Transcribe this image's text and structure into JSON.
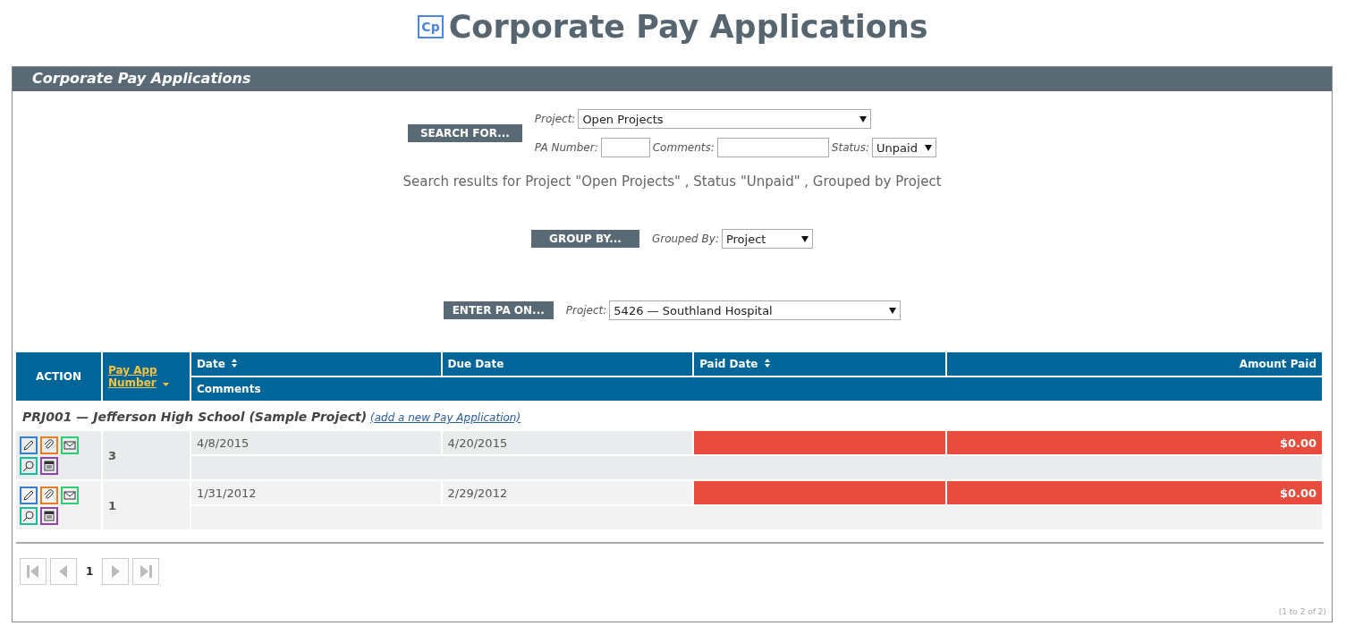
{
  "page_title": {
    "logo": "Cp",
    "text": "Corporate Pay Applications"
  },
  "panel": {
    "title": "Corporate Pay Applications"
  },
  "search": {
    "button": "SEARCH FOR...",
    "project_label": "Project:",
    "project_value": "Open Projects",
    "pa_label": "PA Number:",
    "comments_label": "Comments:",
    "status_label": "Status:",
    "status_value": "Unpaid",
    "summary": "Search results for Project \"Open Projects\" , Status \"Unpaid\" , Grouped by Project"
  },
  "group_by": {
    "button": "GROUP BY...",
    "label": "Grouped By:",
    "value": "Project"
  },
  "enter_pa": {
    "button": "ENTER PA ON...",
    "label": "Project:",
    "value": "5426 — Southland Hospital"
  },
  "table": {
    "columns": [
      {
        "label": "ACTION",
        "sortable": false,
        "sorted": false
      },
      {
        "label": "Pay App Number",
        "sortable": true,
        "sorted": true
      },
      {
        "label": "Date",
        "sortable": true,
        "sorted": false
      },
      {
        "label": "Due Date",
        "sortable": false,
        "sorted": false
      },
      {
        "label": "Paid Date",
        "sortable": true,
        "sorted": false
      },
      {
        "label": "Amount Paid",
        "sortable": false,
        "sorted": false
      }
    ],
    "sub_column": "Comments",
    "group": {
      "title": "PRJ001 — Jefferson High School (Sample Project)",
      "link": "(add a new Pay Application)"
    },
    "rows": [
      {
        "number": "3",
        "date": "4/8/2015",
        "due_date": "4/20/2015",
        "amount_paid": "$0.00",
        "overdue": true,
        "actions": [
          {
            "kind": "edit",
            "color": "#3a7dc9"
          },
          {
            "kind": "attach",
            "color": "#e67e22"
          },
          {
            "kind": "email",
            "color": "#2ecc71"
          },
          {
            "kind": "view",
            "color": "#1abc9c"
          },
          {
            "kind": "calendar",
            "color": "#8e44ad"
          }
        ]
      },
      {
        "number": "1",
        "date": "1/31/2012",
        "due_date": "2/29/2012",
        "amount_paid": "$0.00",
        "overdue": true,
        "actions": [
          {
            "kind": "edit",
            "color": "#3a7dc9"
          },
          {
            "kind": "attach",
            "color": "#e67e22"
          },
          {
            "kind": "email",
            "color": "#2ecc71"
          },
          {
            "kind": "view",
            "color": "#1abc9c"
          },
          {
            "kind": "calendar",
            "color": "#8e44ad"
          }
        ]
      }
    ]
  },
  "pagination": {
    "items": [
      {
        "kind": "first"
      },
      {
        "kind": "prev"
      },
      {
        "kind": "page",
        "label": "1"
      },
      {
        "kind": "next"
      },
      {
        "kind": "last"
      }
    ],
    "range": "(1 to 2 of 2)"
  }
}
